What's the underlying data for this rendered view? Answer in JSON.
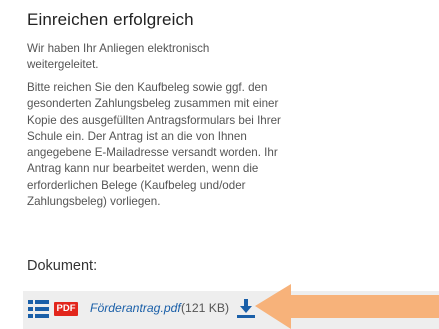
{
  "confirmation": {
    "title": "Einreichen erfolgreich",
    "paragraph_1": "Wir haben Ihr Anliegen elektronisch weitergeleitet.",
    "paragraph_2": "Bitte reichen Sie den Kaufbeleg sowie ggf. den gesonderten Zahlungsbeleg zusammen mit einer Kopie des ausgefüllten Antragsformulars bei Ihrer Schule ein. Der Antrag ist an die von Ihnen angegebene E-Mailadresse versandt worden. Ihr Antrag kann nur bearbeitet werden, wenn die erforderlichen Belege (Kaufbeleg und/oder Zahlungsbeleg) vorliegen."
  },
  "document": {
    "heading": "Dokument:",
    "badge": "PDF",
    "file_name": "Förderantrag.pdf",
    "file_size": "(121 KB)",
    "icons": {
      "list": "list-icon",
      "download": "download-icon"
    }
  },
  "colors": {
    "list_icon": "#1a5fa8",
    "pdf_badge": "#e2261c",
    "link": "#1a5fa8",
    "download_icon": "#1a5fa8",
    "row_background": "#eeeeee",
    "arrow": "#f7b27a"
  }
}
